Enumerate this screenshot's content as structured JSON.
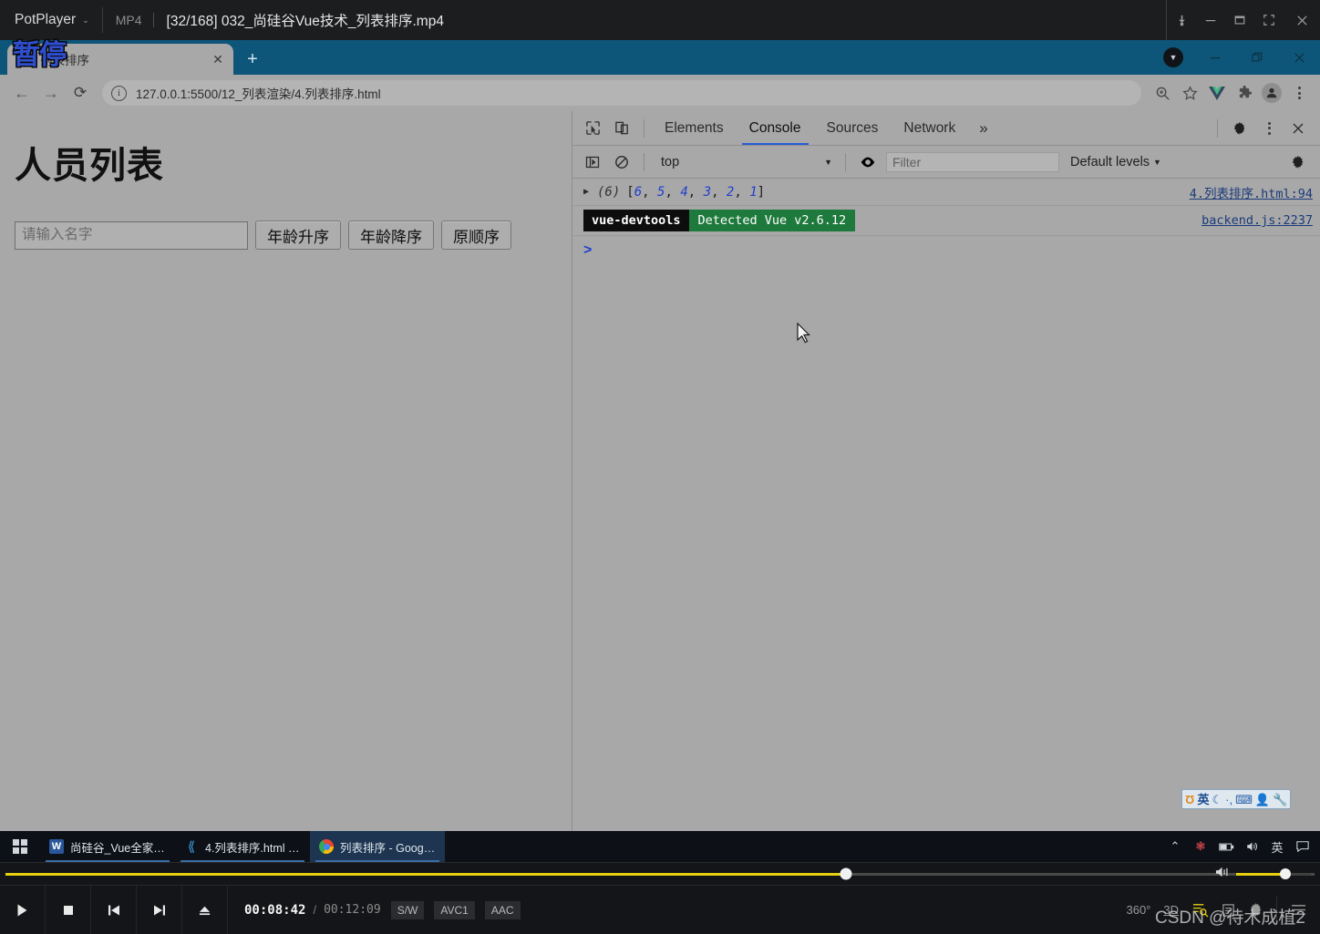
{
  "player": {
    "app_name": "PotPlayer",
    "file_type": "MP4",
    "file_title": "[32/168] 032_尚硅谷Vue技术_列表排序.mp4",
    "osd_text": "暂停",
    "time_current": "00:08:42",
    "time_separator": "/",
    "time_total": "00:12:09",
    "codec_badges": [
      "S/W",
      "AVC1",
      "AAC"
    ],
    "progress_percent": 64,
    "volume_percent": 66,
    "watermark": "CSDN @待木成植2",
    "right_controls": [
      "360°",
      "3D",
      "playlist-search-icon",
      "subtitle-icon",
      "settings-gear-icon",
      "menu-icon"
    ],
    "window_buttons": [
      "pin-icon",
      "minimize-icon",
      "maximize-icon",
      "fullscreen-icon",
      "close-icon"
    ],
    "transport": [
      "play-icon",
      "stop-icon",
      "previous-icon",
      "next-icon",
      "eject-icon"
    ]
  },
  "chrome": {
    "tab": {
      "title": "列表排序",
      "close_label": "✕"
    },
    "new_tab_label": "+",
    "nav": {
      "back": "←",
      "forward": "→",
      "reload": "⟳"
    },
    "omnibox": {
      "url": "127.0.0.1:5500/12_列表渲染/4.列表排序.html",
      "info_label": "i"
    },
    "toolbar_icons": [
      "zoom-magnifier-icon",
      "bookmark-star-icon",
      "vue-devtools-icon",
      "extensions-icon",
      "profile-avatar-icon",
      "chrome-menu-icon"
    ],
    "window_buttons": [
      "download-badge-icon",
      "minimize-icon",
      "restore-icon",
      "close-icon"
    ]
  },
  "page": {
    "heading": "人员列表",
    "search_placeholder": "请输入名字",
    "search_value": "",
    "buttons": [
      {
        "label": "年龄升序"
      },
      {
        "label": "年龄降序"
      },
      {
        "label": "原顺序"
      }
    ]
  },
  "devtools": {
    "tabs": [
      {
        "label": "Elements",
        "active": false
      },
      {
        "label": "Console",
        "active": true
      },
      {
        "label": "Sources",
        "active": false
      },
      {
        "label": "Network",
        "active": false
      }
    ],
    "more_tabs_label": "»",
    "left_icons": [
      "inspect-element-icon",
      "device-toolbar-icon"
    ],
    "right_icons": [
      "settings-gear-icon",
      "more-options-icon",
      "close-devtools-icon"
    ],
    "filterbar": {
      "sidebar_toggle": "show-console-sidebar-icon",
      "clear_label": "clear-console-icon",
      "context": "top",
      "context_caret": "▼",
      "eye_icon": "live-expression-eye-icon",
      "filter_placeholder": "Filter",
      "filter_value": "",
      "levels_label": "Default levels",
      "levels_caret": "▼",
      "settings_icon": "console-settings-gear-icon"
    },
    "console_rows": [
      {
        "type": "array-log",
        "expander": "▶",
        "count": "(6)",
        "value": "[6, 5, 4, 3, 2, 1]",
        "items": [
          "6",
          "5",
          "4",
          "3",
          "2",
          "1"
        ],
        "source": "4.列表排序.html:94"
      },
      {
        "type": "badge-log",
        "badge_dark": "vue-devtools",
        "badge_green": "Detected Vue v2.6.12",
        "source": "backend.js:2237"
      }
    ],
    "prompt": ">"
  },
  "ime": {
    "items": [
      "sogou-logo-icon",
      "英",
      "moon-icon",
      "punctuation-icon",
      "keyboard-icon",
      "user-icon",
      "toolbox-wrench-icon"
    ]
  },
  "taskbar": {
    "start_label": "start-button",
    "items": [
      {
        "label": "尚硅谷_Vue全家桶.d...",
        "icon": "word-icon",
        "active": false
      },
      {
        "label": "4.列表排序.html - vu...",
        "icon": "vscode-icon",
        "active": false
      },
      {
        "label": "列表排序 - Google ...",
        "icon": "chrome-icon",
        "active": true
      }
    ],
    "tray": [
      "chevron-up-icon",
      "sogou-tray-icon",
      "battery-icon",
      "volume-icon",
      "英",
      "notifications-icon"
    ]
  },
  "colors": {
    "chrome_frame": "#0d5579",
    "page_bg": "#a8a8a8",
    "accent_blue": "#2a5bd7",
    "vue_green": "#1e7a3c",
    "player_yellow": "#e8d011",
    "link_blue": "#1a3a7a"
  }
}
